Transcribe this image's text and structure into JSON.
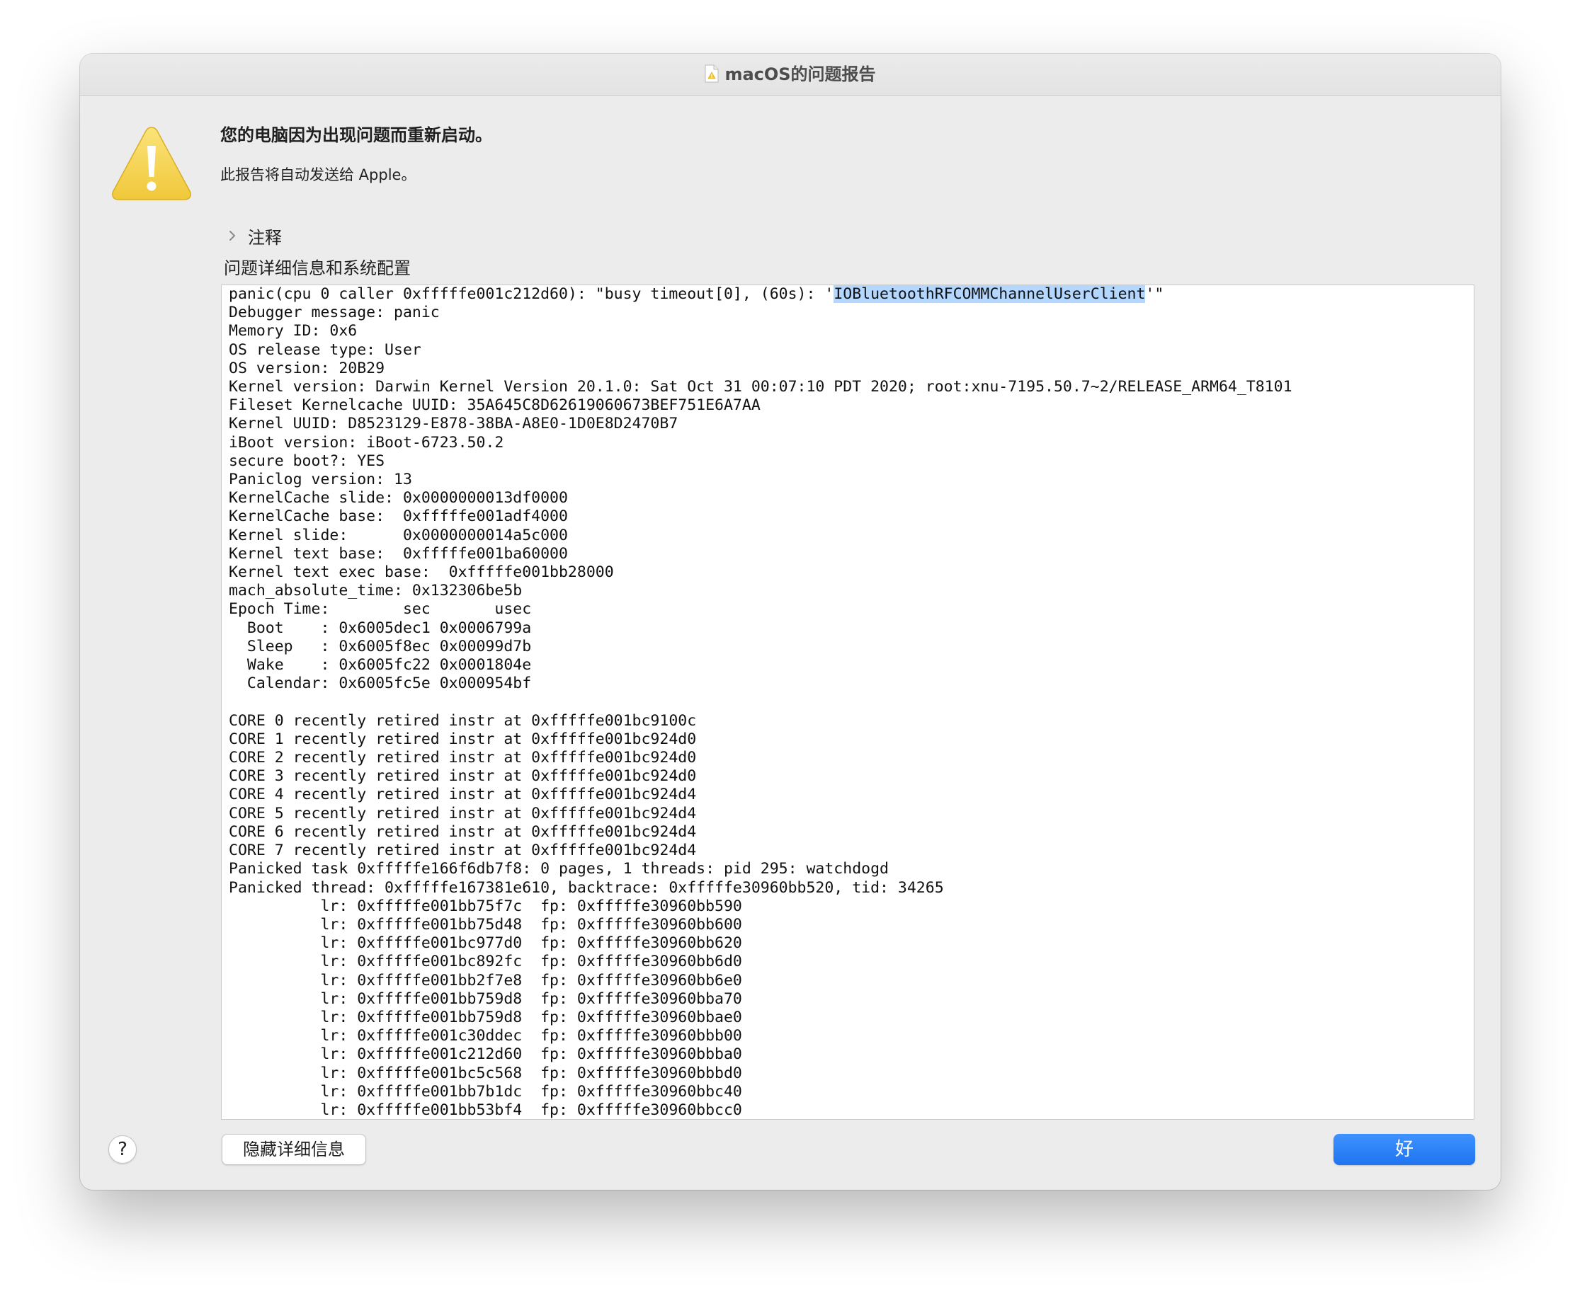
{
  "window": {
    "title": "macOS的问题报告"
  },
  "alert": {
    "heading": "您的电脑因为出现问题而重新启动。",
    "subtext": "此报告将自动发送给 Apple。"
  },
  "comments": {
    "label": "注释"
  },
  "details": {
    "label": "问题详细信息和系统配置",
    "first_line_prefix": "panic(cpu 0 caller 0xfffffe001c212d60): \"busy timeout[0], (60s): '",
    "first_line_selected": "IOBluetoothRFCOMMChannelUserClient",
    "first_line_suffix": "'\"",
    "log": "Debugger message: panic\nMemory ID: 0x6\nOS release type: User\nOS version: 20B29\nKernel version: Darwin Kernel Version 20.1.0: Sat Oct 31 00:07:10 PDT 2020; root:xnu-7195.50.7~2/RELEASE_ARM64_T8101\nFileset Kernelcache UUID: 35A645C8D62619060673BEF751E6A7AA\nKernel UUID: D8523129-E878-38BA-A8E0-1D0E8D2470B7\niBoot version: iBoot-6723.50.2\nsecure boot?: YES\nPaniclog version: 13\nKernelCache slide: 0x0000000013df0000\nKernelCache base:  0xfffffe001adf4000\nKernel slide:      0x0000000014a5c000\nKernel text base:  0xfffffe001ba60000\nKernel text exec base:  0xfffffe001bb28000\nmach_absolute_time: 0x132306be5b\nEpoch Time:        sec       usec\n  Boot    : 0x6005dec1 0x0006799a\n  Sleep   : 0x6005f8ec 0x00099d7b\n  Wake    : 0x6005fc22 0x0001804e\n  Calendar: 0x6005fc5e 0x000954bf\n\nCORE 0 recently retired instr at 0xfffffe001bc9100c\nCORE 1 recently retired instr at 0xfffffe001bc924d0\nCORE 2 recently retired instr at 0xfffffe001bc924d0\nCORE 3 recently retired instr at 0xfffffe001bc924d0\nCORE 4 recently retired instr at 0xfffffe001bc924d4\nCORE 5 recently retired instr at 0xfffffe001bc924d4\nCORE 6 recently retired instr at 0xfffffe001bc924d4\nCORE 7 recently retired instr at 0xfffffe001bc924d4\nPanicked task 0xfffffe166f6db7f8: 0 pages, 1 threads: pid 295: watchdogd\nPanicked thread: 0xfffffe167381e610, backtrace: 0xfffffe30960bb520, tid: 34265\n          lr: 0xfffffe001bb75f7c  fp: 0xfffffe30960bb590\n          lr: 0xfffffe001bb75d48  fp: 0xfffffe30960bb600\n          lr: 0xfffffe001bc977d0  fp: 0xfffffe30960bb620\n          lr: 0xfffffe001bc892fc  fp: 0xfffffe30960bb6d0\n          lr: 0xfffffe001bb2f7e8  fp: 0xfffffe30960bb6e0\n          lr: 0xfffffe001bb759d8  fp: 0xfffffe30960bba70\n          lr: 0xfffffe001bb759d8  fp: 0xfffffe30960bbae0\n          lr: 0xfffffe001c30ddec  fp: 0xfffffe30960bbb00\n          lr: 0xfffffe001c212d60  fp: 0xfffffe30960bbba0\n          lr: 0xfffffe001bc5c568  fp: 0xfffffe30960bbbd0\n          lr: 0xfffffe001bb7b1dc  fp: 0xfffffe30960bbc40\n          lr: 0xfffffe001bb53bf4  fp: 0xfffffe30960bbcc0"
  },
  "buttons": {
    "help": "?",
    "hide_details": "隐藏详细信息",
    "ok": "好"
  },
  "icons": {
    "title_doc": "document-warning-icon",
    "alert": "warning-triangle-icon",
    "disclosure": "chevron-right-icon"
  },
  "colors": {
    "window_bg": "#ececec",
    "accent": "#1f74f0",
    "selection": "#b3d7ff",
    "warning_yellow": "#f6d44a"
  }
}
